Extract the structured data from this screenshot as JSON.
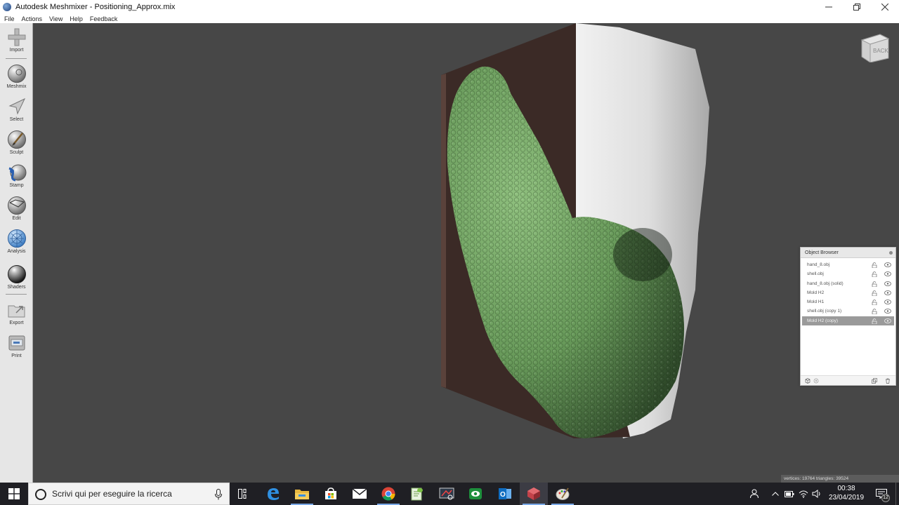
{
  "window": {
    "title": "Autodesk Meshmixer - Positioning_Approx.mix",
    "controls": [
      "minimize",
      "restore",
      "close"
    ]
  },
  "menu": [
    "File",
    "Actions",
    "View",
    "Help",
    "Feedback"
  ],
  "toolbar": {
    "tools": [
      {
        "label": "Import",
        "icon": "plus-icon"
      },
      {
        "label": "Meshmix",
        "icon": "meshmix-sphere-icon"
      },
      {
        "label": "Select",
        "icon": "select-arrow-icon"
      },
      {
        "label": "Sculpt",
        "icon": "sculpt-brush-icon"
      },
      {
        "label": "Stamp",
        "icon": "stamp-icon"
      },
      {
        "label": "Edit",
        "icon": "edit-sphere-icon"
      },
      {
        "label": "Analysis",
        "icon": "analysis-globe-icon"
      },
      {
        "label": "Shaders",
        "icon": "shader-sphere-icon"
      },
      {
        "label": "Export",
        "icon": "export-folder-icon"
      },
      {
        "label": "Print",
        "icon": "printer-icon"
      }
    ]
  },
  "viewport": {
    "viewcube_face": "BACK",
    "status": "vertices: 19764 triangles: 39524"
  },
  "object_browser": {
    "title": "Object Browser",
    "objects": [
      {
        "name": "hand_8.obj",
        "selected": false
      },
      {
        "name": "shell.obj",
        "selected": false
      },
      {
        "name": "hand_8.obj (solid)",
        "selected": false
      },
      {
        "name": "Mold H2",
        "selected": false
      },
      {
        "name": "Mold H1",
        "selected": false
      },
      {
        "name": "shell.obj (copy 1)",
        "selected": false
      },
      {
        "name": "Mold H2 (copy)",
        "selected": true
      }
    ]
  },
  "taskbar": {
    "search_placeholder": "Scrivi qui per eseguire la ricerca",
    "apps": [
      "task-view",
      "edge",
      "file-explorer",
      "store",
      "mail",
      "chrome",
      "notepad-plus",
      "screen-snip",
      "media-app",
      "outlook",
      "meshmixer",
      "paint"
    ],
    "time": "00:38",
    "date": "23/04/2019",
    "notification_count": "12"
  },
  "colors": {
    "viewport_bg": "#474747",
    "mold_green": "#6a9a5c",
    "mold_box": "#3a2a26",
    "shell_white": "#e6e6e6",
    "taskbar_bg": "#1f1f24"
  }
}
